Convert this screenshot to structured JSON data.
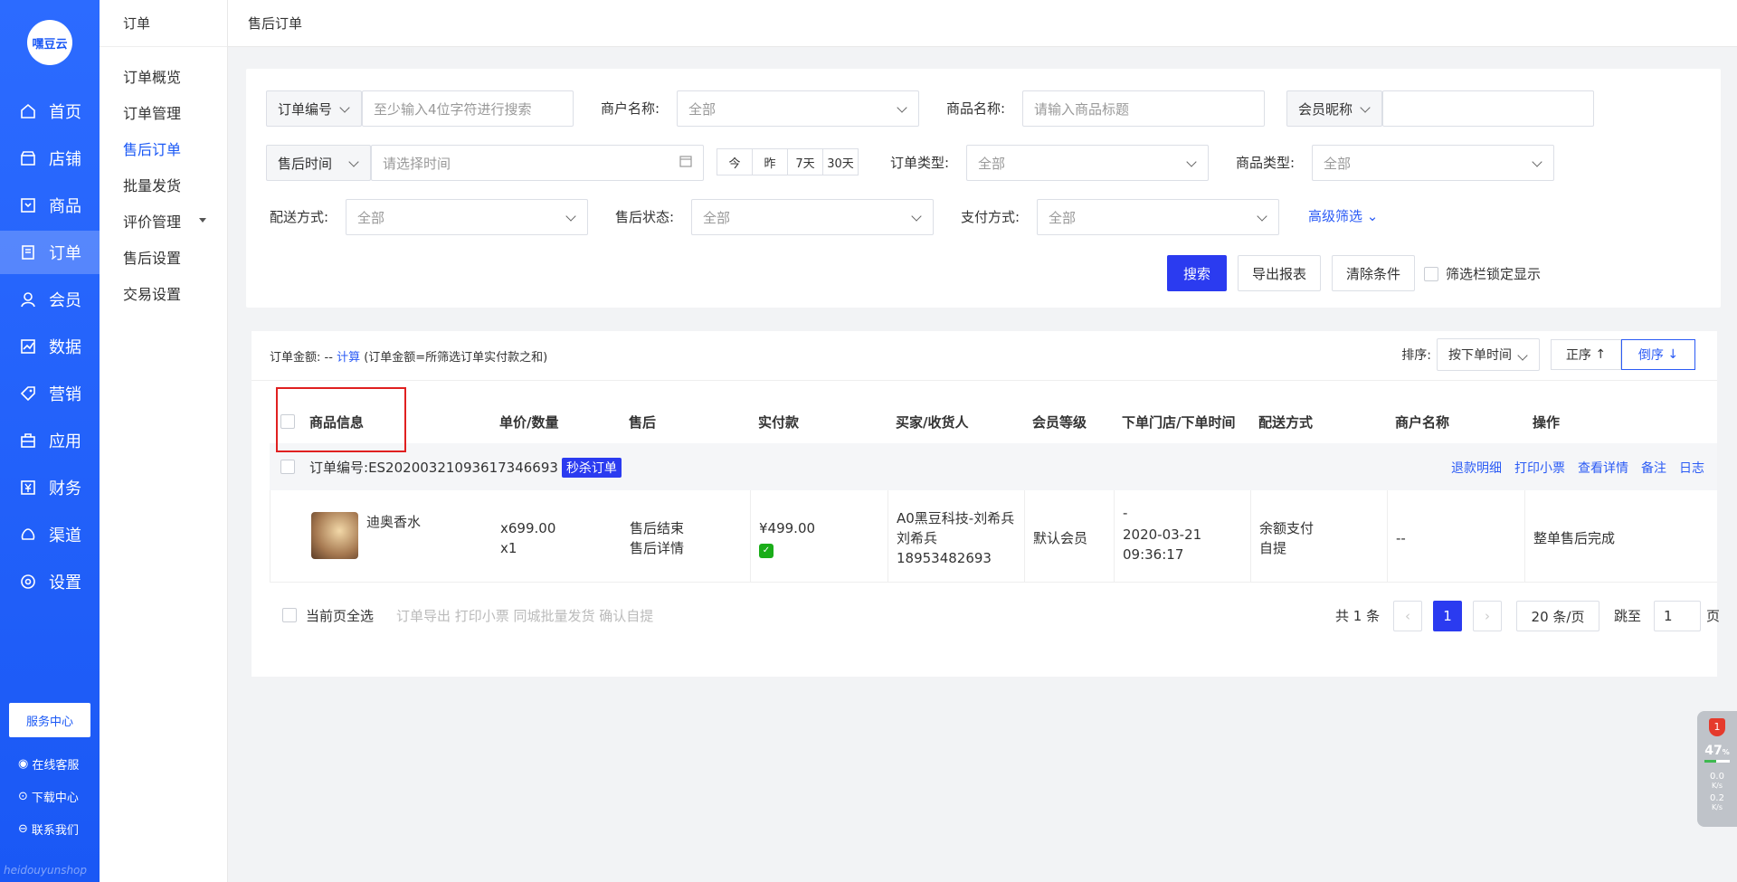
{
  "brand": {
    "logo_text": "嘿豆云",
    "footer_text": "heidouyunshop"
  },
  "nav": {
    "items": [
      {
        "label": "首页",
        "icon": "home-icon"
      },
      {
        "label": "店铺",
        "icon": "store-icon"
      },
      {
        "label": "商品",
        "icon": "goods-icon"
      },
      {
        "label": "订单",
        "icon": "order-icon",
        "active": true
      },
      {
        "label": "会员",
        "icon": "member-icon"
      },
      {
        "label": "数据",
        "icon": "chart-icon"
      },
      {
        "label": "营销",
        "icon": "tag-icon"
      },
      {
        "label": "应用",
        "icon": "app-icon"
      },
      {
        "label": "财务",
        "icon": "finance-icon"
      },
      {
        "label": "渠道",
        "icon": "channel-icon"
      },
      {
        "label": "设置",
        "icon": "gear-icon"
      }
    ],
    "service_center": "服务中心",
    "online_service": "在线客服",
    "download_center": "下载中心",
    "contact_us": "联系我们"
  },
  "submenu": {
    "title": "订单",
    "items": [
      "订单概览",
      "订单管理",
      "售后订单",
      "批量发货",
      "评价管理",
      "售后设置",
      "交易设置"
    ],
    "active": "售后订单"
  },
  "breadcrumb": "售后订单",
  "filters": {
    "order_no_select": "订单编号",
    "order_no_placeholder": "至少输入4位字符进行搜索",
    "merchant_label": "商户名称:",
    "merchant_value": "全部",
    "goods_name_label": "商品名称:",
    "goods_name_placeholder": "请输入商品标题",
    "member_select": "会员昵称",
    "member_value": "",
    "aftersale_time_select": "售后时间",
    "time_placeholder": "请选择时间",
    "date_chips": [
      "今",
      "昨",
      "7天",
      "30天"
    ],
    "order_type_label": "订单类型:",
    "order_type_value": "全部",
    "goods_type_label": "商品类型:",
    "goods_type_value": "全部",
    "delivery_label": "配送方式:",
    "delivery_value": "全部",
    "aftersale_status_label": "售后状态:",
    "aftersale_status_value": "全部",
    "payment_label": "支付方式:",
    "payment_value": "全部",
    "advanced": "高级筛选",
    "search_btn": "搜索",
    "export_btn": "导出报表",
    "clear_btn": "清除条件",
    "lock_label": "筛选栏锁定显示"
  },
  "table": {
    "summary_prefix": "订单金额:",
    "summary_value": "--",
    "summary_link": "计算",
    "summary_note": "(订单金额=所筛选订单实付款之和)",
    "sort_label": "排序:",
    "sort_value": "按下单时间",
    "asc_btn": "正序",
    "desc_btn": "倒序",
    "headers": [
      "商品信息",
      "单价/数量",
      "售后",
      "实付款",
      "买家/收货人",
      "会员等级",
      "下单门店/下单时间",
      "配送方式",
      "商户名称",
      "操作"
    ],
    "order": {
      "label": "订单编号:",
      "number": "ES20200321093617346693",
      "tag": "秒杀订单",
      "ops": [
        "退款明细",
        "打印小票",
        "查看详情",
        "备注",
        "日志"
      ]
    },
    "row": {
      "product_name": "迪奥香水",
      "price": "x699.00",
      "qty": "x1",
      "aftersale_status": "售后结束",
      "aftersale_detail": "售后详情",
      "paid": "¥499.00",
      "buyer_link": "A0黑豆科技-刘希兵",
      "receiver": "刘希兵",
      "phone": "18953482693",
      "member_level": "默认会员",
      "store": "-",
      "order_time": "2020-03-21 09:36:17",
      "pay_method": "余额支付",
      "delivery": "自提",
      "merchant": "--",
      "operation": "整单售后完成"
    },
    "footer": {
      "select_all": "当前页全选",
      "bulk_actions": "订单导出 打印小票 同城批量发货 确认自提",
      "total": "共 1 条",
      "current_page": "1",
      "page_size": "20 条/页",
      "jump_label": "跳至",
      "jump_value": "1",
      "page_suffix": "页"
    }
  },
  "widget": {
    "badge": "1",
    "percent": "47",
    "percent_unit": "%",
    "up": "0.0",
    "down": "0.2",
    "unit": "K/s"
  }
}
